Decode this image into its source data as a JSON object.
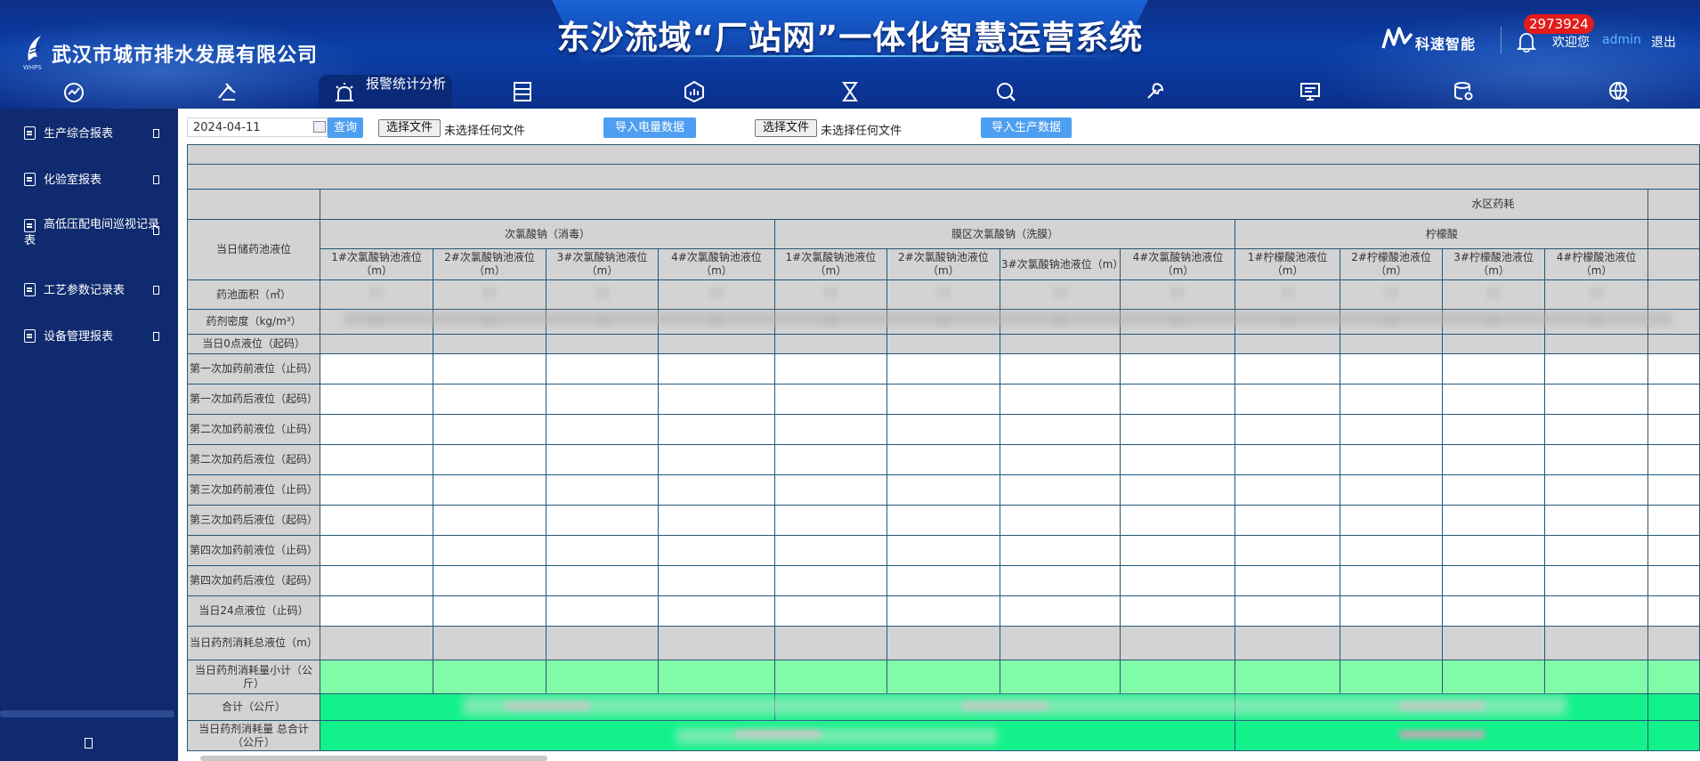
{
  "header": {
    "company": "武汉市城市排水发展有限公司",
    "logo_sub": "WHPS",
    "system_title": "东沙流域“厂站网”一体化智慧运营系统",
    "brand": "科速智能",
    "badge": "2973924",
    "welcome": "欢迎您",
    "user": "admin",
    "logout": "退出"
  },
  "nav": {
    "active_label": "报警统计分析",
    "icons": [
      "dashboard-icon",
      "pipeline-icon",
      "alarm-icon",
      "server-icon",
      "report-chart-icon",
      "hourglass-icon",
      "search-settings-icon",
      "maintenance-icon",
      "monitor-icon",
      "database-search-icon",
      "global-search-icon"
    ]
  },
  "sidebar": {
    "items": [
      {
        "label": "生产综合报表"
      },
      {
        "label": "化验室报表"
      },
      {
        "label": "高低压配电间巡视记录表"
      },
      {
        "label": "工艺参数记录表"
      },
      {
        "label": "设备管理报表"
      }
    ]
  },
  "toolbar": {
    "date": "2024-04-11",
    "query": "查询",
    "choose_file_1": "选择文件",
    "no_file_1": "未选择任何文件",
    "import_power": "导入电量数据",
    "choose_file_2": "选择文件",
    "no_file_2": "未选择任何文件",
    "import_prod": "导入生产数据"
  },
  "table": {
    "group_top": "水区药耗",
    "corner": "当日储药池液位",
    "groups": [
      "次氯酸钠（消毒）",
      "膜区次氯酸钠（洗膜）",
      "柠檬酸"
    ],
    "columns": [
      "1#次氯酸钠池液位（m）",
      "2#次氯酸钠池液位（m）",
      "3#次氯酸钠池液位（m）",
      "4#次氯酸钠池液位（m）",
      "1#次氯酸钠池液位（m）",
      "2#次氯酸钠池液位（m）",
      "3#次氯酸钠池液位（m）",
      "4#次氯酸钠池液位（m）",
      "1#柠檬酸池液位（m）",
      "2#柠檬酸池液位（m）",
      "3#柠檬酸池液位（m）",
      "4#柠檬酸池液位（m）"
    ],
    "rows": [
      "药池面积（㎡）",
      "药剂密度（kg/m³）",
      "当日0点液位（起码）",
      "第一次加药前液位（止码）",
      "第一次加药后液位（起码）",
      "第二次加药前液位（止码）",
      "第二次加药后液位（起码）",
      "第三次加药前液位（止码）",
      "第三次加药后液位（起码）",
      "第四次加药前液位（止码）",
      "第四次加药后液位（起码）",
      "当日24点液位（止码）",
      "当日药剂消耗总液位（m）",
      "当日药剂消耗量小计（公斤）",
      "合计（公斤）",
      "当日药剂消耗量 总合计（公斤）"
    ]
  }
}
